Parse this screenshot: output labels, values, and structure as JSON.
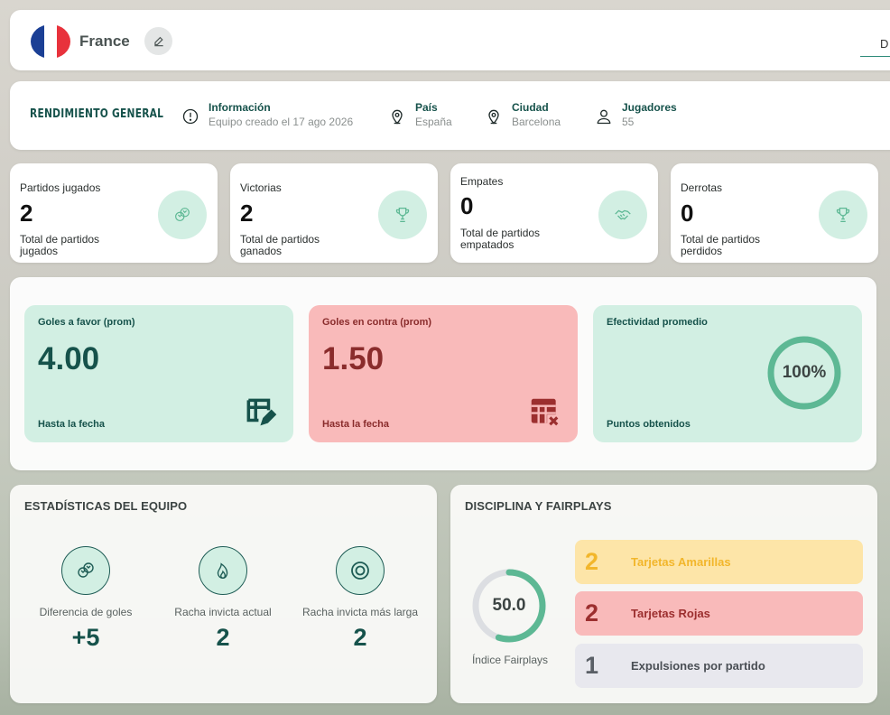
{
  "team": {
    "name": "France",
    "flag_colors": [
      "#1b3f95",
      "#ffffff",
      "#e8323c"
    ]
  },
  "header_right_text": "D",
  "info": {
    "title": "RENDIMIENTO GENERAL",
    "items": [
      {
        "label": "Información",
        "value": "Equipo creado el 17 ago 2026",
        "icon": "info-circle-icon"
      },
      {
        "label": "País",
        "value": "España",
        "icon": "map-pin-icon"
      },
      {
        "label": "Ciudad",
        "value": "Barcelona",
        "icon": "map-pin-icon"
      },
      {
        "label": "Jugadores",
        "value": "55",
        "icon": "user-icon"
      }
    ]
  },
  "stats": [
    {
      "label": "Partidos jugados",
      "value": "2",
      "sub": "Total de partidos jugados",
      "icon": "balls-icon"
    },
    {
      "label": "Victorias",
      "value": "2",
      "sub": "Total de partidos ganados",
      "icon": "trophy-icon"
    },
    {
      "label": "Empates",
      "value": "0",
      "sub": "Total de partidos empatados",
      "icon": "handshake-icon"
    },
    {
      "label": "Derrotas",
      "value": "0",
      "sub": "Total de partidos perdidos",
      "icon": "trophy-icon"
    }
  ],
  "averages": {
    "goals_for": {
      "title": "Goles a favor (prom)",
      "value": "4.00",
      "footer": "Hasta la fecha",
      "icon": "table-edit-icon"
    },
    "goals_against": {
      "title": "Goles en contra (prom)",
      "value": "1.50",
      "footer": "Hasta la fecha",
      "icon": "table-x-icon"
    },
    "effectiveness": {
      "title": "Efectividad promedio",
      "value": "100%",
      "percent": 100,
      "footer": "Puntos obtenidos"
    }
  },
  "team_stats": {
    "title": "ESTADÍSTICAS DEL EQUIPO",
    "items": [
      {
        "label": "Diferencia de goles",
        "value": "+5",
        "icon": "balls-icon"
      },
      {
        "label": "Racha invicta actual",
        "value": "2",
        "icon": "flame-icon"
      },
      {
        "label": "Racha invicta más larga",
        "value": "2",
        "icon": "target-icon"
      }
    ]
  },
  "discipline": {
    "title": "DISCIPLINA Y FAIRPLAYS",
    "fairplay_value": "50.0",
    "fairplay_percent": 55,
    "fairplay_label": "Índice Fairplays",
    "rows": [
      {
        "num": "2",
        "label": "Tarjetas Amarillas"
      },
      {
        "num": "2",
        "label": "Tarjetas Rojas"
      },
      {
        "num": "1",
        "label": "Expulsiones por partido"
      }
    ]
  },
  "colors": {
    "accent": "#16524b",
    "mint": "#d2efe3",
    "red_card": "#f9baba",
    "yellow_card": "#fde5a8",
    "gray_row": "#e8e8ee",
    "gauge_green": "#5db894"
  }
}
